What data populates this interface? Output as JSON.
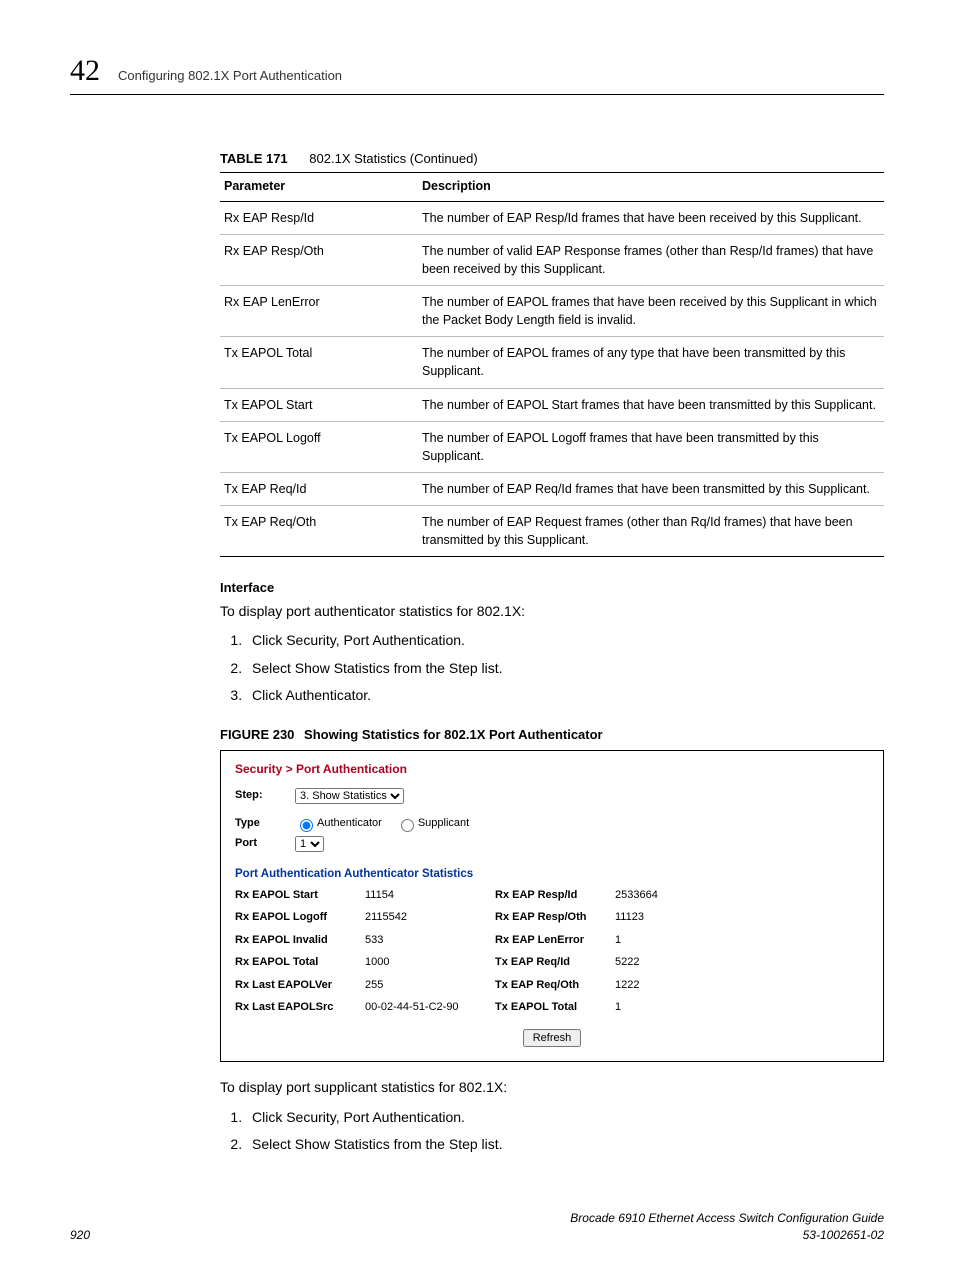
{
  "header": {
    "chapter_number": "42",
    "chapter_title": "Configuring 802.1X Port Authentication"
  },
  "table": {
    "label": "TABLE 171",
    "title": "802.1X Statistics (Continued)",
    "col1": "Parameter",
    "col2": "Description",
    "rows": [
      {
        "p": "Rx EAP Resp/Id",
        "d": "The number of EAP Resp/Id frames that have been received by this Supplicant."
      },
      {
        "p": "Rx EAP Resp/Oth",
        "d": "The number of valid EAP Response frames (other than Resp/Id frames) that have been received by this Supplicant."
      },
      {
        "p": "Rx EAP LenError",
        "d": "The number of EAPOL frames that have been received by this Supplicant in which the Packet Body Length field is invalid."
      },
      {
        "p": "Tx EAPOL Total",
        "d": "The number of EAPOL frames of any type that have been transmitted by this Supplicant."
      },
      {
        "p": "Tx EAPOL Start",
        "d": "The number of EAPOL Start frames that have been transmitted by this Supplicant."
      },
      {
        "p": "Tx EAPOL Logoff",
        "d": "The number of EAPOL Logoff frames that have been transmitted by this Supplicant."
      },
      {
        "p": "Tx EAP Req/Id",
        "d": "The number of EAP Req/Id frames that have been transmitted by this Supplicant."
      },
      {
        "p": "Tx EAP Req/Oth",
        "d": "The number of EAP Request frames (other than Rq/Id frames) that have been transmitted by this Supplicant."
      }
    ]
  },
  "interface": {
    "heading": "Interface",
    "intro1": "To display port authenticator statistics for 802.1X:",
    "steps1": [
      "Click Security, Port Authentication.",
      "Select Show Statistics from the Step list.",
      "Click Authenticator."
    ],
    "intro2": "To display port supplicant statistics for 802.1X:",
    "steps2": [
      "Click Security, Port Authentication.",
      "Select Show Statistics from the Step list."
    ]
  },
  "figure": {
    "label": "FIGURE 230",
    "title": "Showing Statistics for 802.1X Port Authenticator",
    "breadcrumb": "Security > Port Authentication",
    "step_label": "Step:",
    "step_value": "3. Show Statistics",
    "type_label": "Type",
    "type_opt1": "Authenticator",
    "type_opt2": "Supplicant",
    "port_label": "Port",
    "port_value": "1",
    "sub_header": "Port Authentication Authenticator Statistics",
    "stats": {
      "l0": "Rx EAPOL Start",
      "v0": "11154",
      "r0": "Rx EAP Resp/Id",
      "rv0": "2533664",
      "l1": "Rx EAPOL Logoff",
      "v1": "2115542",
      "r1": "Rx EAP Resp/Oth",
      "rv1": "11123",
      "l2": "Rx EAPOL Invalid",
      "v2": "533",
      "r2": "Rx EAP LenError",
      "rv2": "1",
      "l3": "Rx EAPOL Total",
      "v3": "1000",
      "r3": "Tx EAP Req/Id",
      "rv3": "5222",
      "l4": "Rx Last EAPOLVer",
      "v4": "255",
      "r4": "Tx EAP Req/Oth",
      "rv4": "1222",
      "l5": "Rx Last EAPOLSrc",
      "v5": "00-02-44-51-C2-90",
      "r5": "Tx EAPOL Total",
      "rv5": "1"
    },
    "refresh": "Refresh"
  },
  "footer": {
    "page": "920",
    "doc_title": "Brocade 6910 Ethernet Access Switch Configuration Guide",
    "doc_num": "53-1002651-02"
  }
}
